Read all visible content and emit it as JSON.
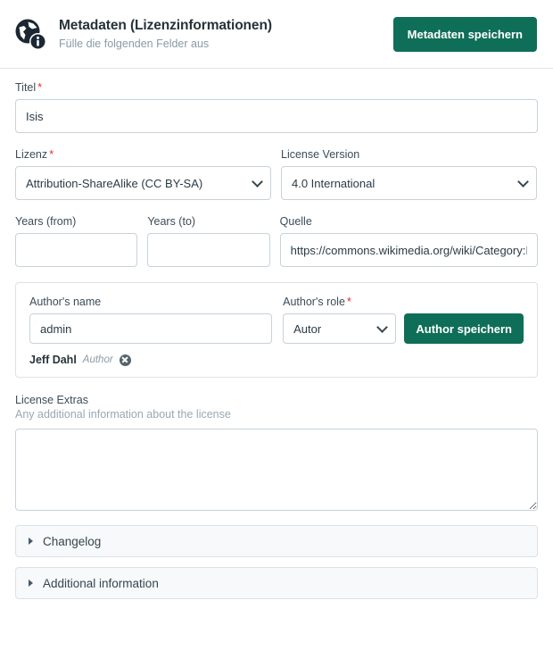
{
  "header": {
    "icon": "globe-info-icon",
    "title": "Metadaten (Lizenzinformationen)",
    "subtitle": "Fülle die folgenden Felder aus",
    "save_button": "Metadaten speichern"
  },
  "form": {
    "title_field": {
      "label": "Titel",
      "required_marker": "*",
      "value": "Isis",
      "placeholder": ""
    },
    "license_field": {
      "label": "Lizenz",
      "required_marker": "*",
      "value": "Attribution-ShareAlike (CC BY-SA)"
    },
    "license_version_field": {
      "label": "License Version",
      "value": "4.0 International"
    },
    "years_from_field": {
      "label": "Years (from)",
      "value": "",
      "placeholder": ""
    },
    "years_to_field": {
      "label": "Years (to)",
      "value": "",
      "placeholder": ""
    },
    "source_field": {
      "label": "Quelle",
      "value": "https://commons.wikimedia.org/wiki/Category:Isis",
      "placeholder": ""
    }
  },
  "author_section": {
    "name_field": {
      "label": "Author's name",
      "value": "admin",
      "placeholder": ""
    },
    "role_field": {
      "label": "Author's role",
      "required_marker": "*",
      "value": "Autor"
    },
    "save_button": "Author speichern",
    "authors": [
      {
        "name": "Jeff Dahl",
        "role": "Author",
        "remove": "remove-author-icon"
      }
    ]
  },
  "license_extras": {
    "label": "License Extras",
    "hint": "Any additional information about the license",
    "value": "",
    "placeholder": ""
  },
  "accordions": [
    {
      "label": "Changelog"
    },
    {
      "label": "Additional information"
    }
  ],
  "colors": {
    "accent_green": "#0f6e58",
    "required_red": "#e03030",
    "border": "#c8d2da",
    "muted_text": "#8a9aa6",
    "panel_bg": "#f7f9fa"
  }
}
